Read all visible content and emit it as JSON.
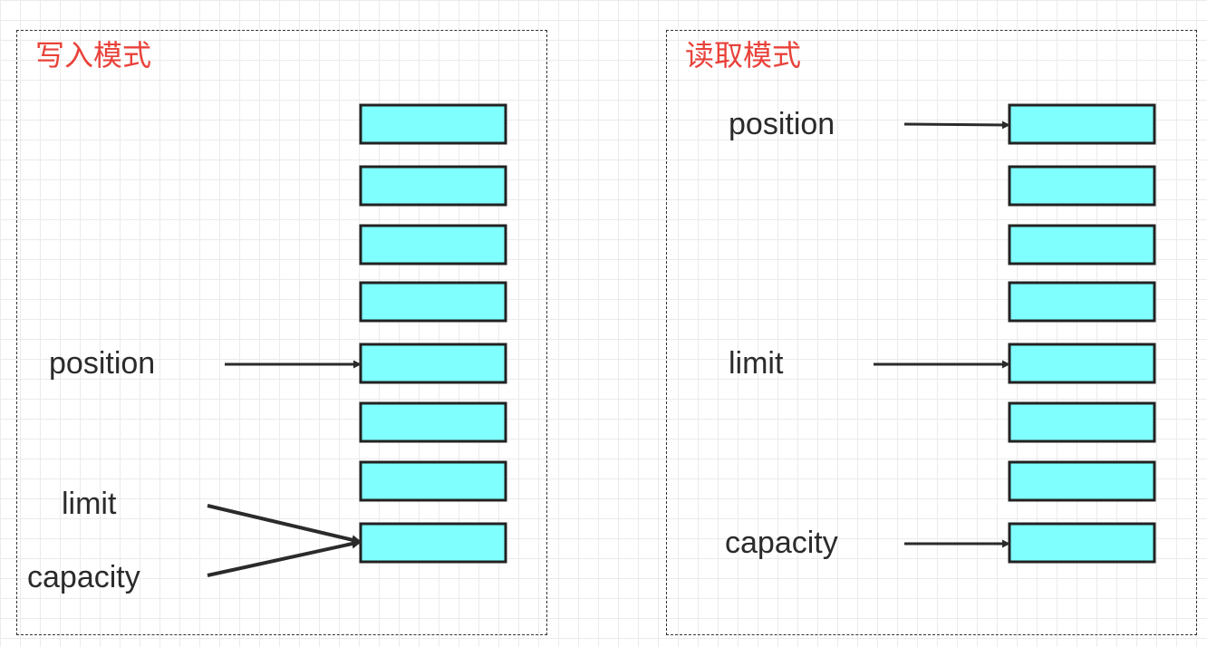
{
  "diagrams": [
    {
      "id": "write",
      "title": "写入模式",
      "slot_count": 8,
      "labels": [
        {
          "key": "position",
          "text": "position",
          "slot": 4
        },
        {
          "key": "limit",
          "text": "limit",
          "slot": 7
        },
        {
          "key": "capacity",
          "text": "capacity",
          "slot": 7
        }
      ]
    },
    {
      "id": "read",
      "title": "读取模式",
      "slot_count": 8,
      "labels": [
        {
          "key": "position",
          "text": "position",
          "slot": 0
        },
        {
          "key": "limit",
          "text": "limit",
          "slot": 4
        },
        {
          "key": "capacity",
          "text": "capacity",
          "slot": 7
        }
      ]
    }
  ],
  "colors": {
    "slot_fill": "#80ffff",
    "slot_stroke": "#222222",
    "title": "#e8423a",
    "label": "#2b2b2b",
    "arrow": "#2b2b2b"
  }
}
